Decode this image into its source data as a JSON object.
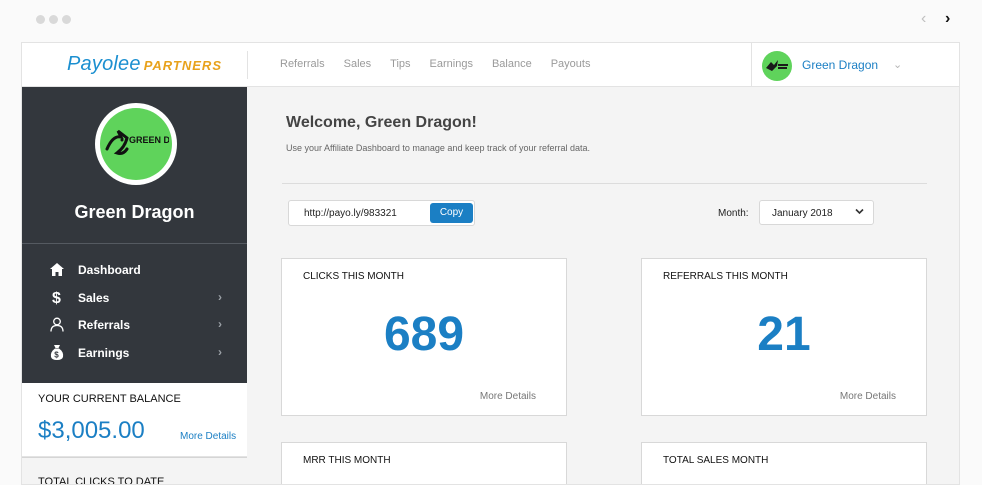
{
  "browser": {
    "prev": "‹",
    "next": "›"
  },
  "header": {
    "logo_main": "Payolee",
    "logo_sub": "PARTNERS",
    "nav": [
      "Referrals",
      "Sales",
      "Tips",
      "Earnings",
      "Balance",
      "Payouts"
    ],
    "user_name": "Green Dragon",
    "caret": "⌄"
  },
  "sidebar": {
    "profile_name": "Green Dragon",
    "avatar_text": "GREEN DRAGONS",
    "menu": [
      {
        "label": "Dashboard",
        "icon": "home-icon",
        "has_chevron": false
      },
      {
        "label": "Sales",
        "icon": "dollar-icon",
        "has_chevron": true
      },
      {
        "label": "Referrals",
        "icon": "user-icon",
        "has_chevron": true
      },
      {
        "label": "Earnings",
        "icon": "money-bag-icon",
        "has_chevron": true
      }
    ],
    "chevron": "›",
    "balance_label": "YOUR CURRENT BALANCE",
    "balance_value": "$3,005.00",
    "balance_more": "More Details",
    "clicks_to_date_label": "TOTAL CLICKS TO DATE"
  },
  "main": {
    "welcome": "Welcome, Green Dragon!",
    "subtitle": "Use your Affiliate Dashboard to manage and keep track of your referral data.",
    "link": "http://payo.ly/983321",
    "copy_label": "Copy",
    "month_label": "Month:",
    "month_value": "January 2018",
    "month_caret": "⌄",
    "cards": [
      {
        "title": "CLICKS THIS MONTH",
        "value": "689",
        "more": "More Details"
      },
      {
        "title": "REFERRALS THIS MONTH",
        "value": "21",
        "more": "More Details"
      },
      {
        "title": "MRR THIS MONTH",
        "value": "",
        "more": ""
      },
      {
        "title": "TOTAL SALES MONTH",
        "value": "",
        "more": ""
      }
    ]
  },
  "colors": {
    "accent": "#1b7fc4",
    "sidebar_bg": "#33373d",
    "avatar_green": "#5fd35b",
    "logo_orange": "#e8a21c"
  }
}
